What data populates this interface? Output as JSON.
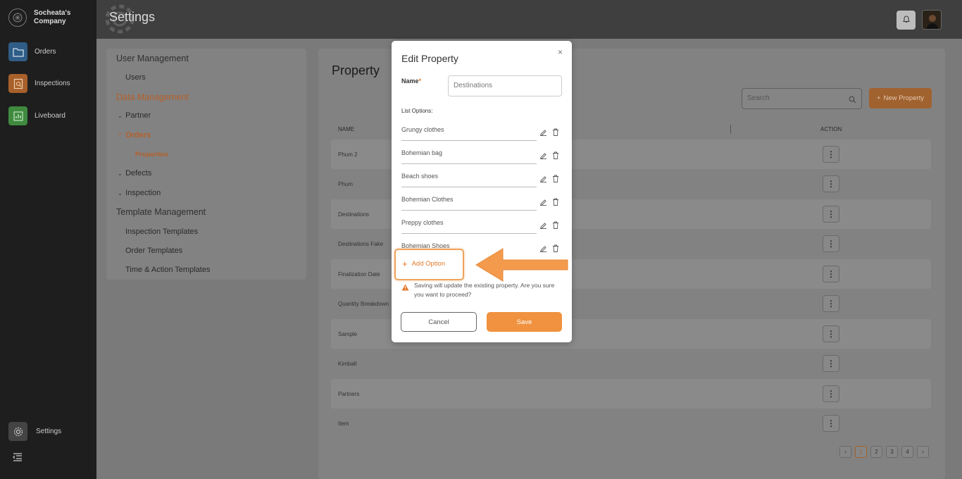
{
  "company": {
    "name": "Socheata's Company"
  },
  "nav": [
    {
      "label": "Orders",
      "icon": "folder-icon",
      "color": "#2f5d86"
    },
    {
      "label": "Inspections",
      "icon": "inspection-icon",
      "color": "#a8602a"
    },
    {
      "label": "Liveboard",
      "icon": "chart-icon",
      "color": "#3f8a3f"
    }
  ],
  "nav_bottom": {
    "settings": "Settings"
  },
  "header": {
    "title": "Settings"
  },
  "settings_menu": {
    "user_management": "User Management",
    "users": "Users",
    "data_management": "Data Management",
    "partner": "Partner",
    "orders": "Orders",
    "properties": "Properties",
    "defects": "Defects",
    "inspection": "Inspection",
    "template_management": "Template Management",
    "inspection_templates": "Inspection Templates",
    "order_templates": "Order Templates",
    "time_action_templates": "Time & Action Templates"
  },
  "property": {
    "title": "Property",
    "search_placeholder": "Search",
    "new_button": "New Property",
    "columns": {
      "name": "NAME",
      "action": "ACTION"
    },
    "rows": [
      "Phum 2",
      "Phum",
      "Destinations",
      "Destinations Fake",
      "Finalization Date",
      "Quantity Breakdown",
      "Sample",
      "Kimball",
      "Partners",
      "Item"
    ],
    "action_glyph": "⋮",
    "pages": [
      "1",
      "2",
      "3",
      "4"
    ],
    "prev": "‹",
    "next": "›"
  },
  "modal": {
    "title": "Edit Property",
    "close": "×",
    "name_label": "Name",
    "required_mark": "*",
    "name_value": "Destinations",
    "list_label": "List Options:",
    "options": [
      "Grungy clothes",
      "Bohemian bag",
      "Beach shoes",
      "Bohemian Clothes",
      "Preppy clothes",
      "Bohemian Shoes"
    ],
    "add_option": "Add Option",
    "add_plus": "+",
    "warning": "Saving will update the existing property. Are you sure you want to proceed?",
    "cancel": "Cancel",
    "save": "Save"
  },
  "colors": {
    "accent": "#f0923f",
    "highlight": "#f0a25c"
  }
}
